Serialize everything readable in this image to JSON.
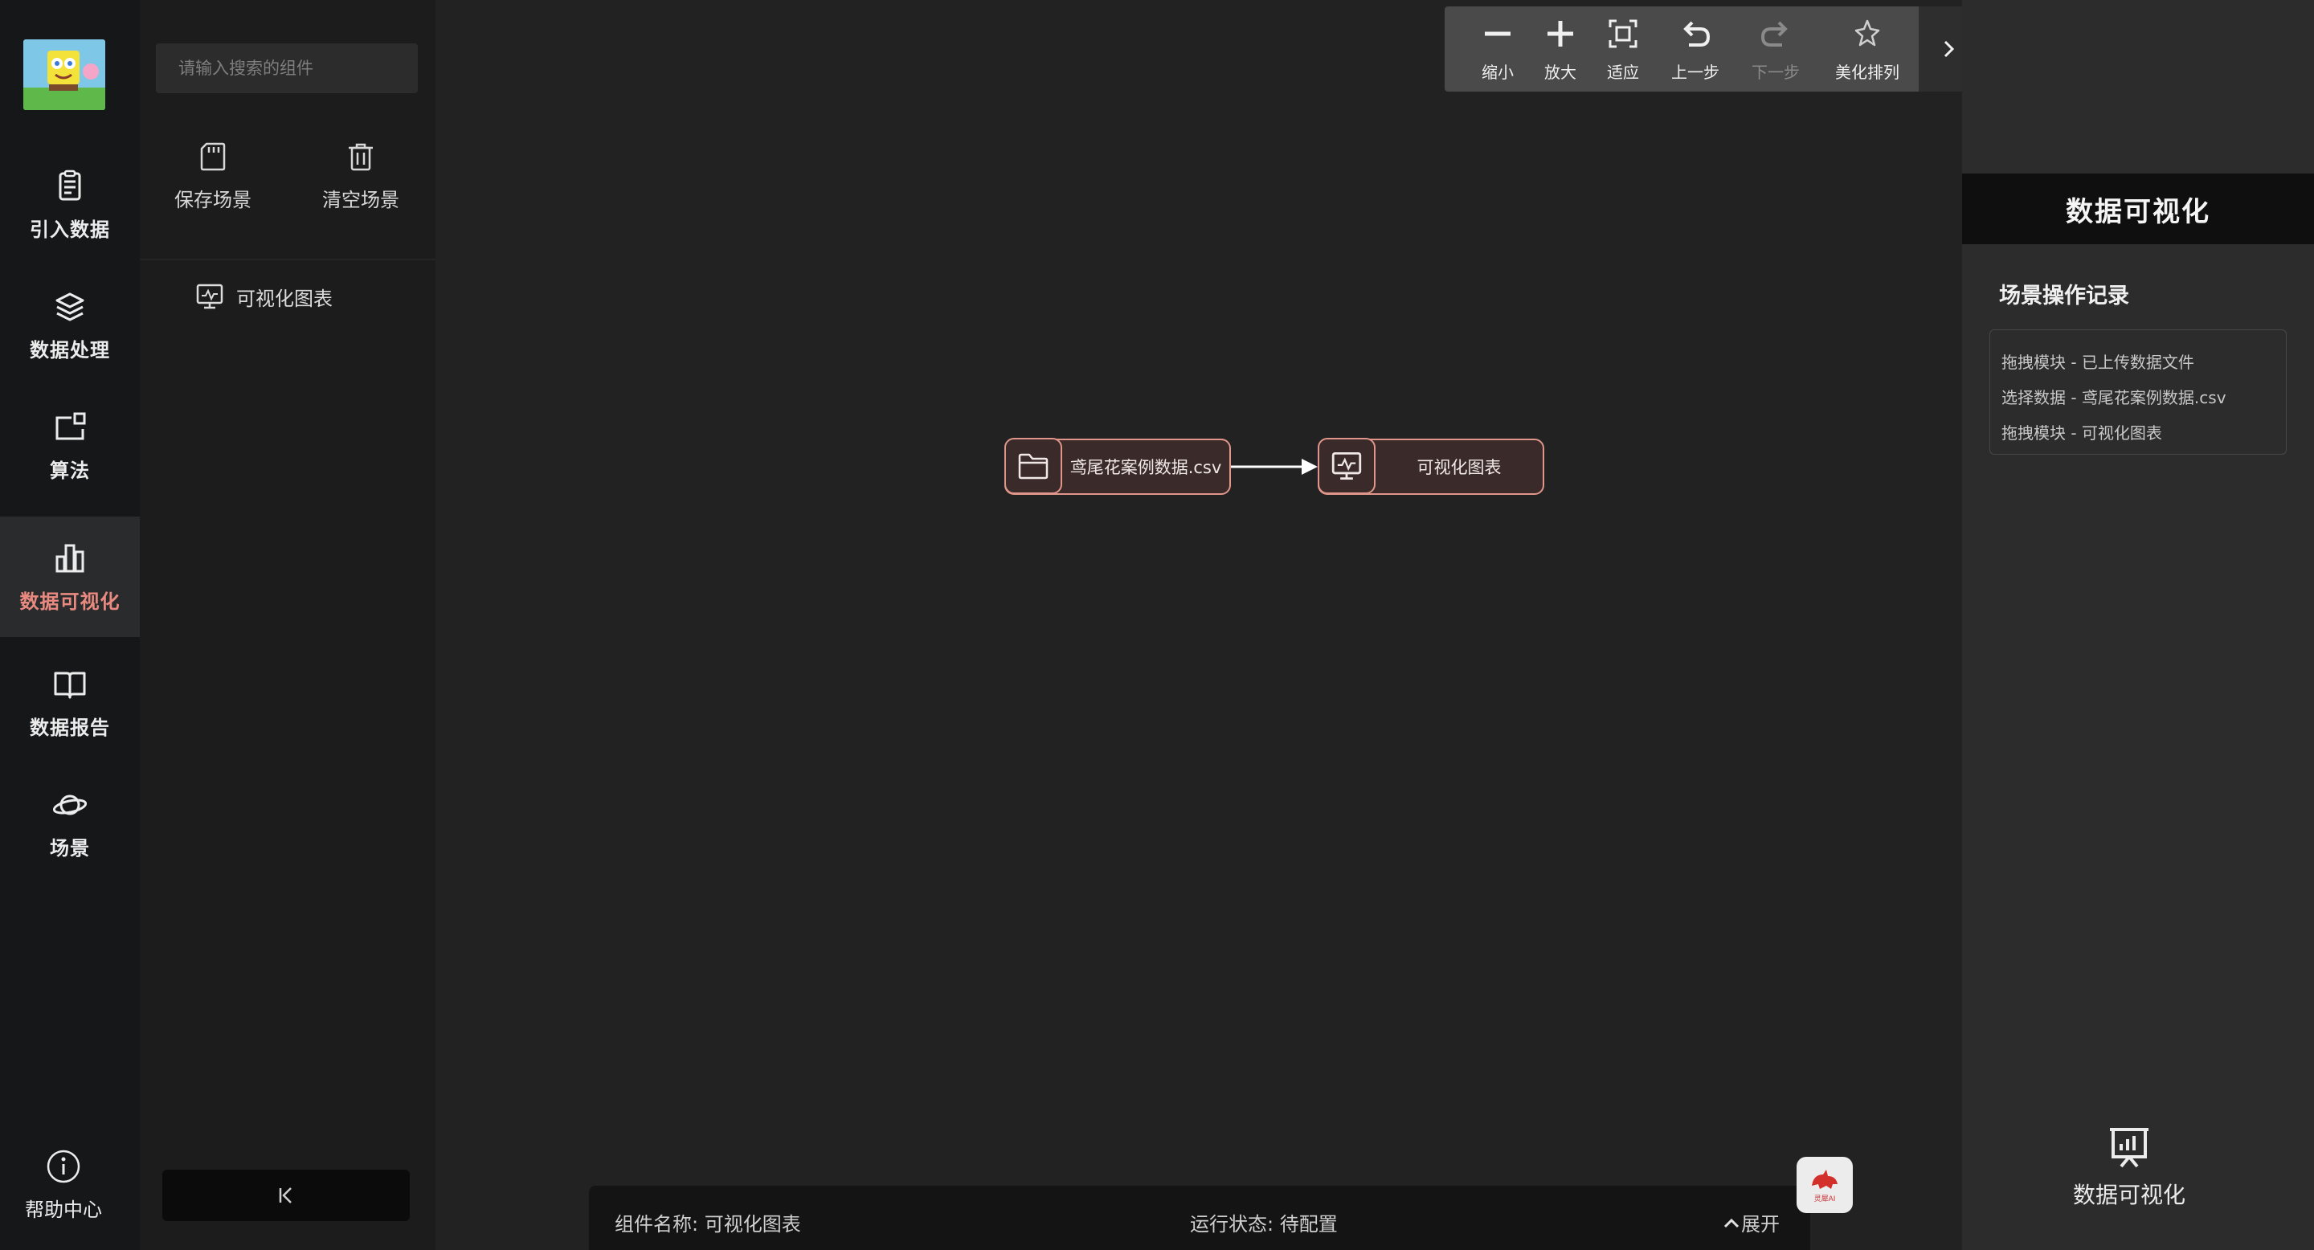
{
  "nav": {
    "items": [
      {
        "label": "引入数据",
        "icon": "import-data-icon"
      },
      {
        "label": "数据处理",
        "icon": "layers-icon"
      },
      {
        "label": "算法",
        "icon": "algorithm-icon"
      },
      {
        "label": "数据可视化",
        "icon": "bar-chart-icon",
        "active": true
      },
      {
        "label": "数据报告",
        "icon": "book-icon"
      },
      {
        "label": "场景",
        "icon": "planet-icon"
      }
    ],
    "help_label": "帮助中心"
  },
  "panel": {
    "search_placeholder": "请输入搜索的组件",
    "save_label": "保存场景",
    "clear_label": "清空场景",
    "component_label": "可视化图表"
  },
  "toolbar": {
    "zoom_out": "缩小",
    "zoom_in": "放大",
    "fit": "适应",
    "undo": "上一步",
    "redo": "下一步",
    "beautify": "美化排列"
  },
  "canvas": {
    "nodes": [
      {
        "label": "鸢尾花案例数据.csv",
        "icon": "folder-icon"
      },
      {
        "label": "可视化图表",
        "icon": "monitor-chart-icon"
      }
    ]
  },
  "status": {
    "name_text": "组件名称: 可视化图表",
    "state_text": "运行状态: 待配置",
    "expand_label": "展开"
  },
  "ai_label": "灵犀AI",
  "right": {
    "header": "数据可视化",
    "section_title": "场景操作记录",
    "logs": [
      "拖拽模块 - 已上传数据文件",
      "选择数据 - 鸢尾花案例数据.csv",
      "拖拽模块 - 可视化图表"
    ],
    "bottom_label": "数据可视化"
  },
  "colors": {
    "accent": "#e98a80",
    "node_border": "#e0968a",
    "sidebar_bg": "#161718",
    "canvas_bg": "#222222"
  }
}
